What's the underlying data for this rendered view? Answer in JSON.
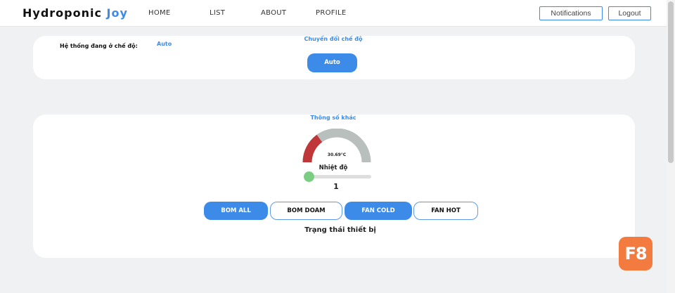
{
  "brand": {
    "name": "Hydroponic",
    "accent": "Joy"
  },
  "nav": {
    "links": [
      "HOME",
      "LIST",
      "ABOUT",
      "PROFILE"
    ],
    "notifications_label": "Notifications",
    "logout_label": "Logout"
  },
  "mode_card": {
    "label": "Hệ thống đang ở chế độ:",
    "current_mode": "Auto",
    "switch_title": "Chuyển đổi chế độ",
    "switch_button": "Auto"
  },
  "params_card": {
    "title": "Thông số khác",
    "gauge": {
      "value_text": "30.69°C",
      "label": "Nhiệt độ",
      "fraction": 0.3
    },
    "slider_value": "1",
    "devices": [
      {
        "label": "BOM ALL",
        "active": true
      },
      {
        "label": "BOM DOAM",
        "active": false
      },
      {
        "label": "FAN COLD",
        "active": true
      },
      {
        "label": "FAN HOT",
        "active": false
      }
    ],
    "status_title": "Trạng thái thiết bị"
  },
  "badge": {
    "text": "F8"
  },
  "colors": {
    "accent": "#3d8be8",
    "gauge_fill": "#c0373a",
    "gauge_track": "#b8bfbd",
    "slider_thumb": "#7ccd84",
    "badge": "#f47b40"
  },
  "icons": {
    "scroll": "scrollbar"
  }
}
